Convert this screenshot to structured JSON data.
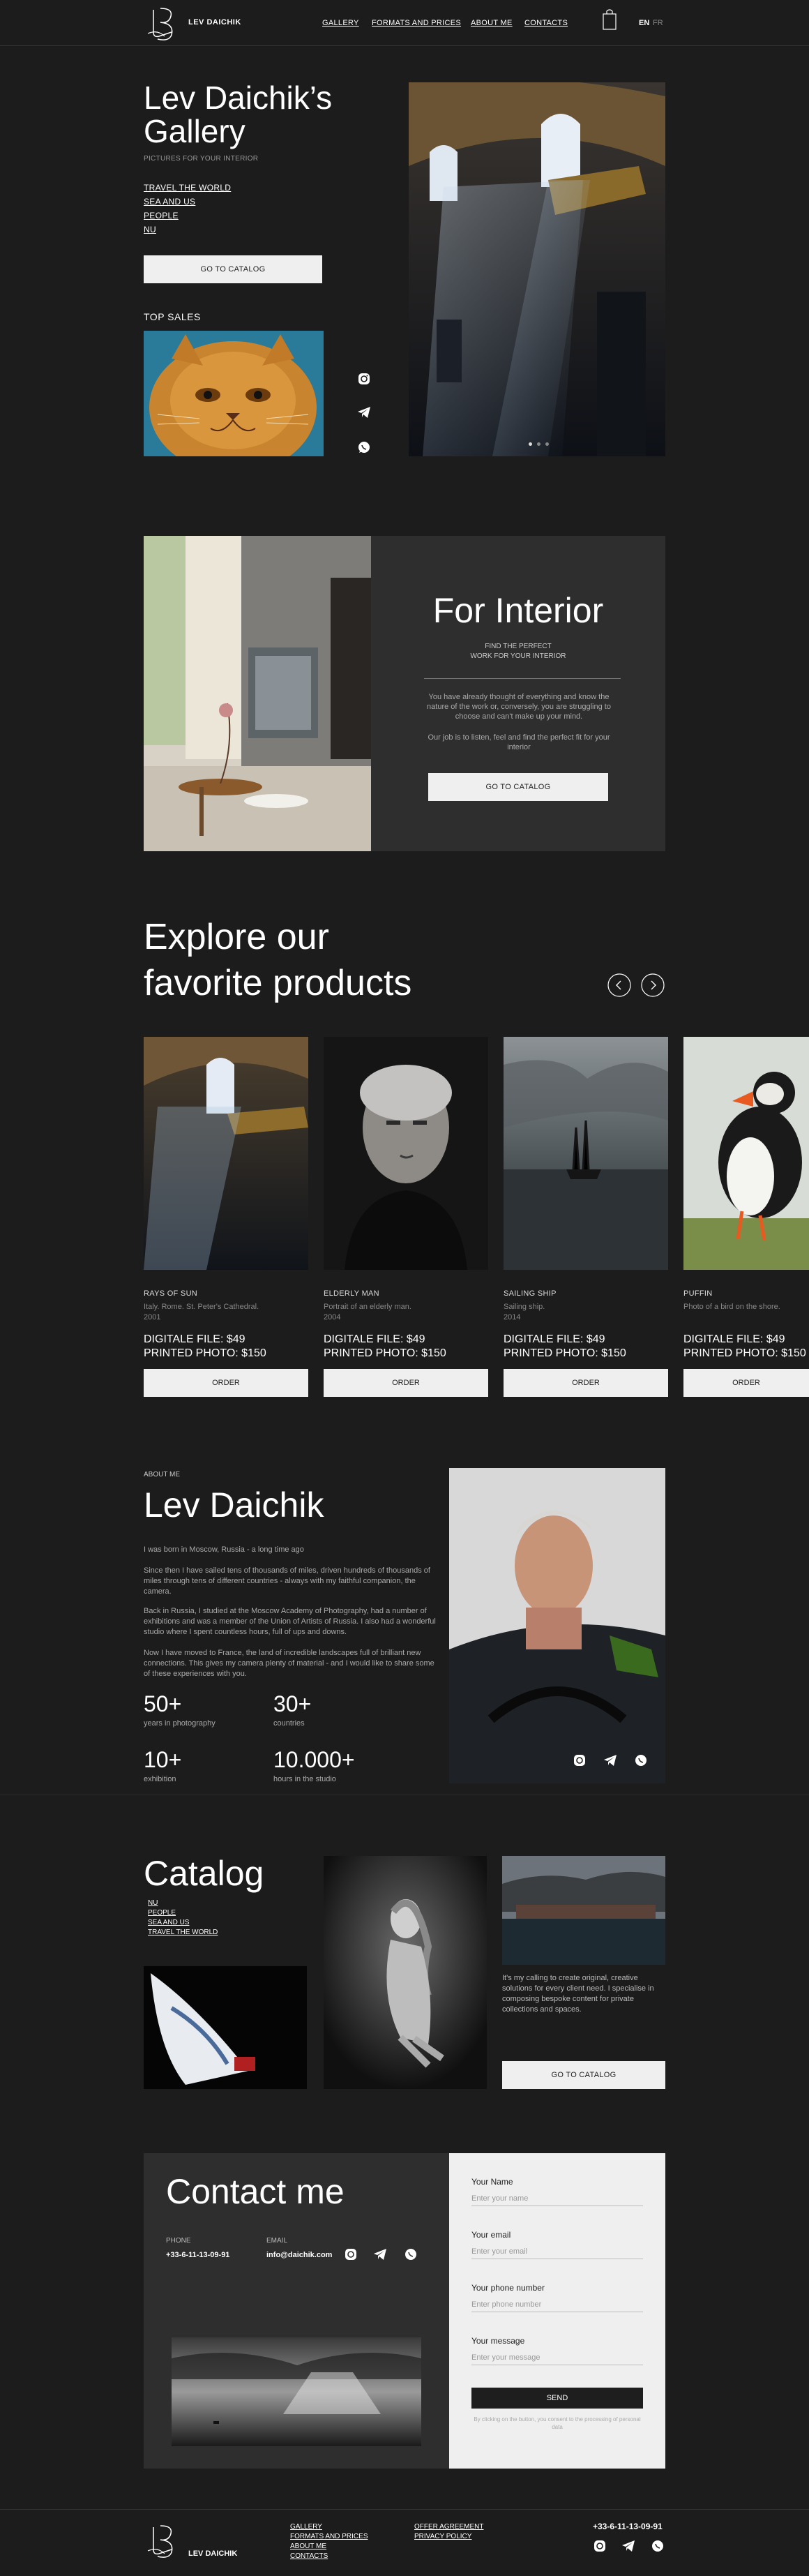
{
  "header": {
    "logo_text": "LEV DAICHIK",
    "nav": [
      "GALLERY",
      "FORMATS AND PRICES",
      "ABOUT ME",
      "CONTACTS"
    ],
    "lang_active": "EN",
    "lang_other": "FR"
  },
  "hero": {
    "title_line1": "Lev Daichik’s",
    "title_line2": "Gallery",
    "subtitle": "PICTURES FOR YOUR INTERIOR",
    "links": [
      "TRAVEL THE WORLD",
      "SEA AND US",
      "PEOPLE",
      "NU"
    ],
    "catalog_button": "GO TO CATALOG",
    "top_sales_label": "TOP SALES",
    "slider_dots": 3
  },
  "interior": {
    "title": "For Interior",
    "subtitle_line1": "FIND THE PERFECT",
    "subtitle_line2": "WORK FOR YOUR INTERIOR",
    "text1": "You have already thought of everything and know the nature of the work or, conversely, you are struggling to choose and can't make up your mind.",
    "text2": "Our job is to listen, feel and find the perfect fit for your interior",
    "button": "GO TO CATALOG"
  },
  "products": {
    "title_line1": "Explore our",
    "title_line2": "favorite products",
    "items": [
      {
        "title": "RAYS OF SUN",
        "desc": "Italy. Rome. St. Peter's Cathedral.",
        "year": "2001",
        "digital": "DIGITALE FILE: $49",
        "printed": "PRINTED PHOTO: $150",
        "button": "ORDER"
      },
      {
        "title": "ELDERLY MAN",
        "desc": "Portrait of an elderly man.",
        "year": "2004",
        "digital": "DIGITALE FILE: $49",
        "printed": "PRINTED PHOTO: $150",
        "button": "ORDER"
      },
      {
        "title": "SAILING SHIP",
        "desc": "Sailing ship.",
        "year": "2014",
        "digital": "DIGITALE FILE: $49",
        "printed": "PRINTED PHOTO: $150",
        "button": "ORDER"
      },
      {
        "title": "PUFFIN",
        "desc": "Photo of a bird on the shore.",
        "year": "",
        "digital": "DIGITALE FILE: $49",
        "printed": "PRINTED PHOTO: $150",
        "button": "ORDER"
      }
    ]
  },
  "about": {
    "label": "ABOUT ME",
    "name": "Lev Daichik",
    "p1": "I was born in Moscow, Russia - a long time ago",
    "p2": "Since then I have sailed tens of thousands of miles, driven hundreds of thousands of miles through tens of different countries - always with my faithful companion, the camera.",
    "p3": "Back in Russia, I studied at the Moscow Academy of Photography, had a number of exhibitions and was a member of the Union of Artists of Russia. I also had a wonderful studio where I spent countless hours, full of ups and downs.",
    "p4": "Now I have moved to France, the land of incredible landscapes full of brilliant new connections. This gives my camera plenty of material - and I would like to share some of these experiences with you.",
    "stats": [
      {
        "num": "50+",
        "label": "years in photography"
      },
      {
        "num": "30+",
        "label": "countries"
      },
      {
        "num": "10+",
        "label": "exhibition"
      },
      {
        "num": "10.000+",
        "label": "hours in the studio"
      }
    ]
  },
  "catalog": {
    "title": "Catalog",
    "links": [
      "NU",
      "PEOPLE",
      "SEA AND US",
      "TRAVEL THE WORLD"
    ],
    "text": "It's my calling to create original, creative solutions for every client need. I specialise in composing bespoke content for private collections and spaces.",
    "button": "GO TO CATALOG"
  },
  "contact": {
    "title": "Contact me",
    "phone_label": "PHONE",
    "phone": "+33-6-11-13-09-91",
    "email_label": "EMAIL",
    "email": "info@daichik.com",
    "fields": [
      {
        "label": "Your Name",
        "placeholder": "Enter your name"
      },
      {
        "label": "Your email",
        "placeholder": "Enter your email"
      },
      {
        "label": "Your phone number",
        "placeholder": "Enter phone number"
      },
      {
        "label": "Your message",
        "placeholder": "Enter your message"
      }
    ],
    "send": "SEND",
    "consent": "By clicking on the button, you consent to the processing of personal data"
  },
  "footer": {
    "logo_text": "LEV DAICHIK",
    "col1": [
      "GALLERY",
      "FORMATS AND PRICES",
      "ABOUT ME",
      "CONTACTS"
    ],
    "col2": [
      "OFFER AGREEMENT",
      "PRIVACY POLICY"
    ],
    "phone": "+33-6-11-13-09-91"
  },
  "colors": {
    "background": "#1c1c1c",
    "panel": "#2e2e2e",
    "light": "#efefef",
    "accent_dark": "#1e1e1e"
  }
}
